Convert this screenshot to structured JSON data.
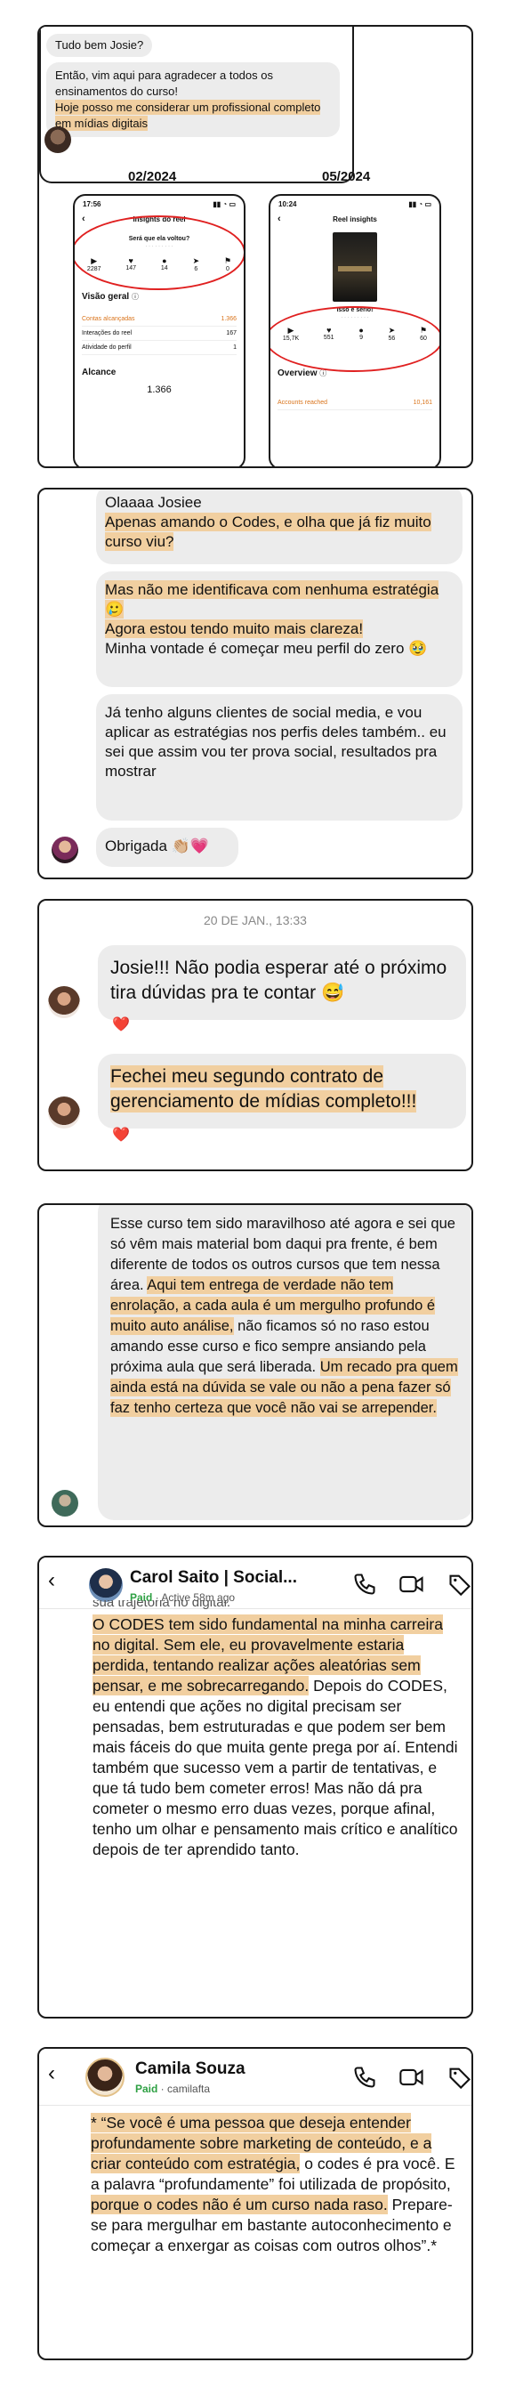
{
  "card1": {
    "message_lines": [
      "Tudo bem Josie?"
    ],
    "message_body": "Então, vim aqui para agradecer a todos os ensinamentos do curso!",
    "message_highlight": "Hoje posso me considerar um profissional completo em mídias digitais",
    "left": {
      "date": "02/2024",
      "time": "17:56",
      "title": "Insights do reel",
      "question": "Será que ela voltou?",
      "stats": [
        "2287",
        "147",
        "14",
        "6",
        "0"
      ],
      "overview_title": "Visão geral",
      "rows": [
        {
          "label": "Contas alcançadas",
          "value": "1.366"
        },
        {
          "label": "Interações do reel",
          "value": "167"
        },
        {
          "label": "Atividade do perfil",
          "value": "1"
        }
      ],
      "reach_title": "Alcance",
      "reach_value": "1.366"
    },
    "right": {
      "date": "05/2024",
      "time": "10:24",
      "title": "Reel insights",
      "caption": "Isso é sério!",
      "stats": [
        "15,7K",
        "551",
        "9",
        "56",
        "60"
      ],
      "overview_title": "Overview",
      "rows": [
        {
          "label": "Accounts reached",
          "value": "10,161"
        }
      ]
    }
  },
  "card2": {
    "b1_plain": "Olaaaa Josiee",
    "b1_hl": "Apenas amando o Codes, e olha que já fiz muito curso viu?",
    "b2_hl1": "Mas não me identificava com nenhuma estratégia 🥲",
    "b2_hl2": "Agora estou tendo muito mais clareza!",
    "b2_plain": "Minha vontade é começar meu perfil do zero 🥹",
    "b3": "Já tenho alguns clientes de social media, e vou aplicar as estratégias nos perfis deles também.. eu sei que assim vou ter prova social, resultados pra mostrar",
    "b4": "Obrigada 👏🏼💗"
  },
  "card3": {
    "timestamp": "20 DE JAN., 13:33",
    "msg1": "Josie!!! Não podia esperar até o próximo tira dúvidas pra te contar 😅",
    "msg2": "Fechei meu segundo contrato de gerenciamento de mídias completo!!!",
    "reaction": "❤️"
  },
  "card4": {
    "p1": "Esse curso tem sido maravilhoso até agora e sei que só vêm mais material bom daqui pra frente, é bem diferente de todos os outros cursos que tem nessa área.",
    "p2": "Aqui tem entrega de verdade não tem enrolação, a cada aula é um mergulho profundo é muito auto análise,",
    "p3": "não ficamos só no raso estou amando esse curso e fico sempre ansiando pela próxima aula que será liberada.",
    "p4": "Um recado pra quem ainda está na dúvida se vale ou não a pena fazer só faz tenho certeza que você não vai se arrepender."
  },
  "card5": {
    "name": "Carol Saito | Social...",
    "paid": "Paid",
    "status": "Active 58m ago",
    "cut_line": "sua trajetória no digital.",
    "hl": "O CODES tem sido fundamental na minha carreira no digital. Sem ele, eu provavelmente estaria perdida, tentando realizar ações aleatórias sem pensar, e me sobrecarregando.",
    "plain": "Depois do CODES, eu entendi que ações no digital precisam ser pensadas, bem estruturadas e que podem ser bem mais fáceis do que muita gente prega por aí. Entendi também que sucesso vem a partir de tentativas, e que tá tudo bem cometer erros! Mas não dá pra cometer o mesmo erro duas vezes, porque afinal, tenho um olhar e pensamento mais crítico e analítico depois de ter aprendido tanto."
  },
  "card6": {
    "name": "Camila Souza",
    "paid": "Paid",
    "handle": "camilafta",
    "hl1": "* “Se você é uma pessoa que deseja entender profundamente sobre marketing de conteúdo, e a criar conteúdo com estratégia,",
    "mid": " o codes é pra você. E a palavra “profundamente” foi utilizada de propósito, ",
    "hl2": "porque o codes não é um curso nada raso.",
    "end": " Prepare-se para mergulhar em bastante autoconhecimento e começar a enxergar as coisas com outros olhos”.*"
  },
  "colors": {
    "highlight": "#f1cfa0",
    "bubble": "#ececec",
    "annotation_red": "#e02020",
    "paid_green": "#2ea043"
  }
}
